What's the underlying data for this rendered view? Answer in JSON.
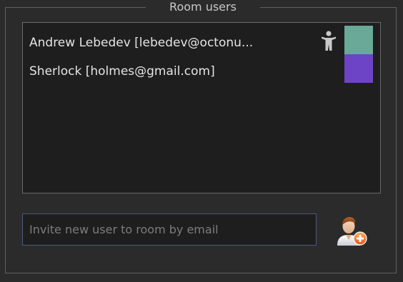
{
  "group": {
    "title": "Room users"
  },
  "users": [
    {
      "label": "Andrew Lebedev [lebedev@octonu...",
      "is_owner": true,
      "icon": "person-icon",
      "color": "#6aa898"
    },
    {
      "label": "Sherlock [holmes@gmail.com]",
      "is_owner": false,
      "color": "#6e44c6"
    }
  ],
  "invite": {
    "placeholder": "Invite new user to room by email",
    "value": "",
    "button_icon": "add-user-icon",
    "accent_color": "#f07a2a"
  },
  "colors": {
    "background": "#2b2b2b",
    "list_background": "#1e1e1e",
    "text": "#e4e4e4",
    "input_border": "#4a5a78"
  }
}
